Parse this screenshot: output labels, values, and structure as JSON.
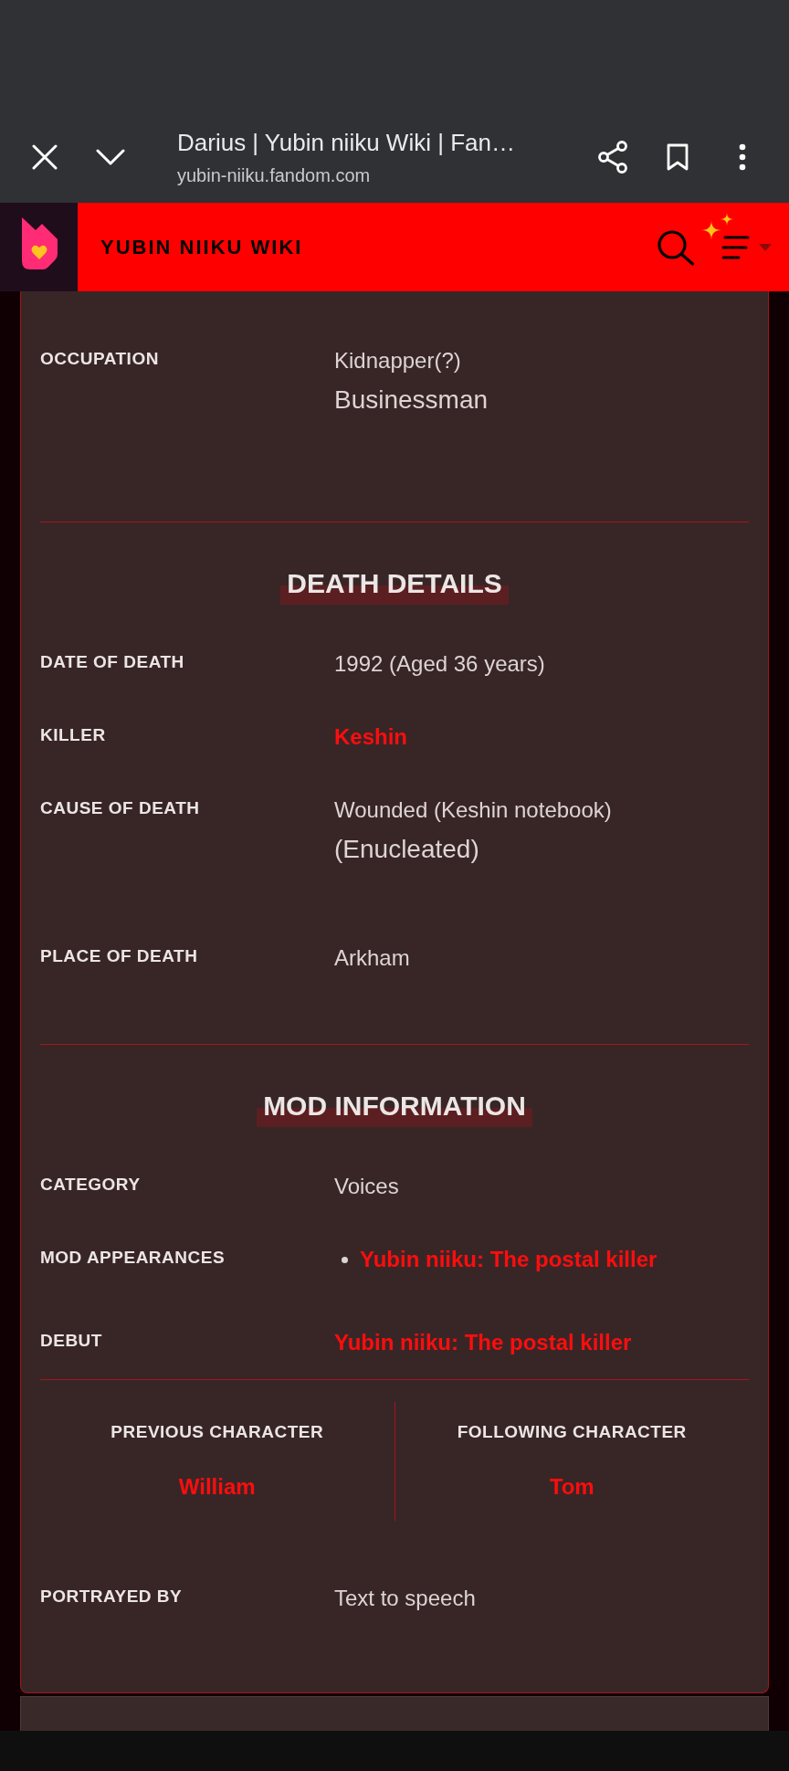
{
  "browser_bar": {
    "page_title": "Darius | Yubin niiku Wiki | Fan…",
    "url": "yubin-niiku.fandom.com"
  },
  "wiki_header": {
    "title": "YUBIN NIIKU WIKI"
  },
  "infobox": {
    "sections": [
      {
        "rows": [
          {
            "kind": "data",
            "label": "OCCUPATION",
            "values": [
              {
                "kind": "text",
                "text": "Kidnapper(?)"
              },
              {
                "kind": "paragraph",
                "text": "Businessman"
              }
            ]
          }
        ]
      },
      {
        "heading": "DEATH DETAILS",
        "rows": [
          {
            "kind": "data",
            "label": "DATE OF DEATH",
            "values": [
              {
                "kind": "text",
                "text": "1992 (Aged 36 years)"
              }
            ]
          },
          {
            "kind": "data",
            "label": "KILLER",
            "values": [
              {
                "kind": "link",
                "text": "Keshin"
              }
            ]
          },
          {
            "kind": "data",
            "label": "CAUSE OF DEATH",
            "values": [
              {
                "kind": "text",
                "text": "Wounded (Keshin notebook)"
              },
              {
                "kind": "paragraph",
                "text": "(Enucleated)"
              }
            ]
          },
          {
            "kind": "data",
            "label": "PLACE OF DEATH",
            "values": [
              {
                "kind": "text",
                "text": "Arkham"
              }
            ]
          }
        ]
      },
      {
        "heading": "MOD INFORMATION",
        "rows": [
          {
            "kind": "data",
            "label": "CATEGORY",
            "values": [
              {
                "kind": "text",
                "text": "Voices"
              }
            ]
          },
          {
            "kind": "data",
            "label": "MOD APPEARANCES",
            "values": [
              {
                "kind": "bullet",
                "text": "Yubin niiku: The postal killer"
              }
            ]
          },
          {
            "kind": "data",
            "label": "DEBUT",
            "values": [
              {
                "kind": "link",
                "text": "Yubin niiku: The postal killer"
              }
            ]
          },
          {
            "kind": "pair",
            "columns": [
              {
                "label": "PREVIOUS CHARACTER",
                "link": "William"
              },
              {
                "label": "FOLLOWING CHARACTER",
                "link": "Tom"
              }
            ]
          },
          {
            "kind": "data",
            "label": "PORTRAYED BY",
            "values": [
              {
                "kind": "text",
                "text": "Text to speech"
              }
            ]
          }
        ]
      }
    ]
  }
}
